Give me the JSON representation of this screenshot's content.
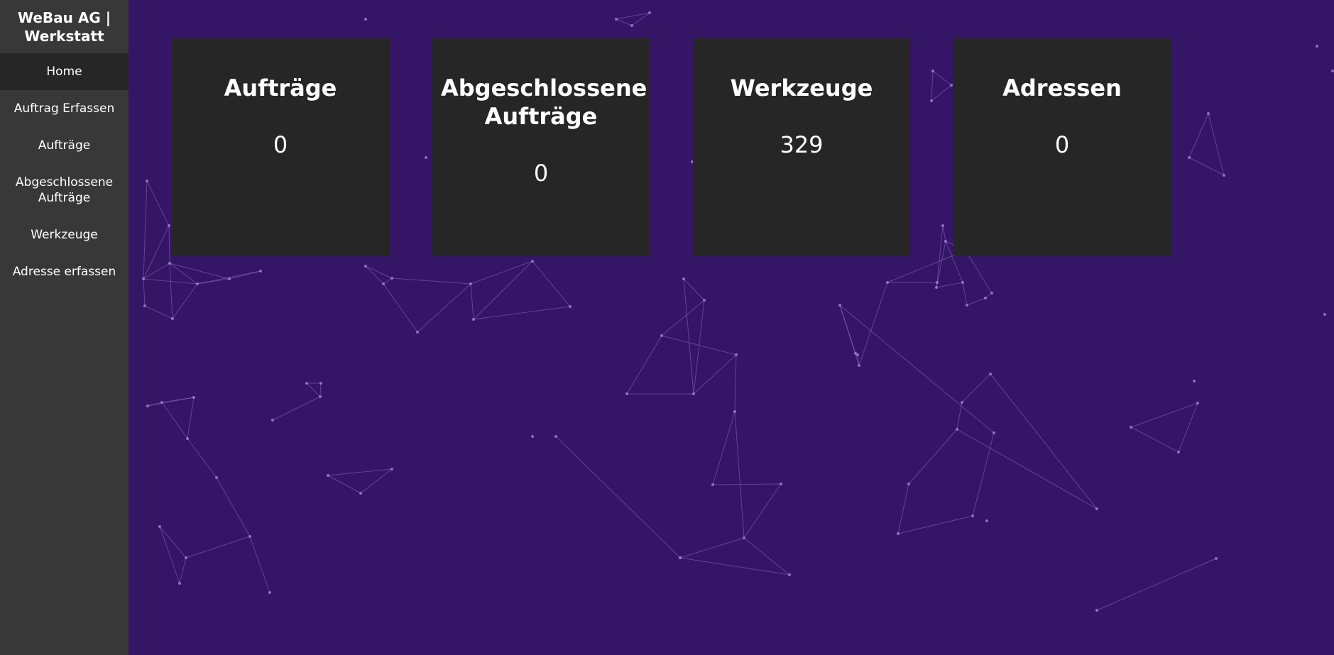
{
  "app": {
    "brand": "WeBau AG | Werkstatt"
  },
  "sidebar": {
    "items": [
      {
        "label": "Home",
        "active": true
      },
      {
        "label": "Auftrag Erfassen",
        "active": false
      },
      {
        "label": "Aufträge",
        "active": false
      },
      {
        "label": "Abgeschlossene Aufträge",
        "active": false
      },
      {
        "label": "Werkzeuge",
        "active": false
      },
      {
        "label": "Adresse erfassen",
        "active": false
      }
    ]
  },
  "cards": [
    {
      "title": "Aufträge",
      "value": "0"
    },
    {
      "title": "Abgeschlossene Aufträge",
      "value": "0"
    },
    {
      "title": "Werkzeuge",
      "value": "329"
    },
    {
      "title": "Adressen",
      "value": "0"
    }
  ],
  "colors": {
    "background": "#351565",
    "sidebar": "#383838",
    "sidebar_active": "#262626",
    "card": "#262626",
    "text": "#ffffff",
    "network_lines": "#9b7fcf"
  }
}
